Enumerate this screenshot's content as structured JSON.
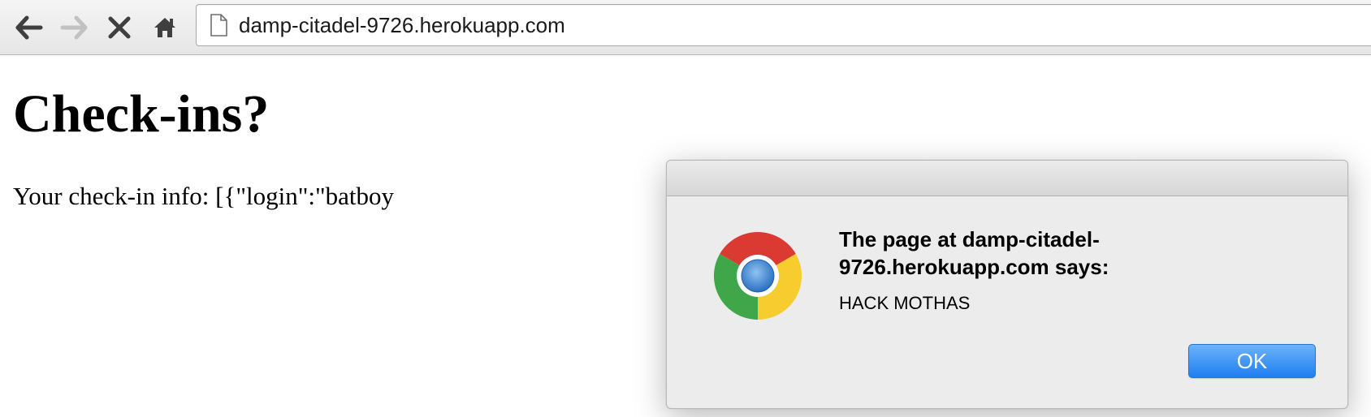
{
  "browser": {
    "url": "damp-citadel-9726.herokuapp.com",
    "icons": {
      "back": "arrow-left-icon",
      "forward": "arrow-right-icon",
      "stop": "close-icon",
      "home": "home-icon",
      "page": "page-icon"
    }
  },
  "page": {
    "title": "Check-ins?",
    "checkin_text": "Your check-in info: [{\"login\":\"batboy"
  },
  "dialog": {
    "heading": "The page at damp-citadel-9726.herokuapp.com says:",
    "message": "HACK MOTHAS",
    "ok_label": "OK",
    "icon": "chrome-logo-icon"
  },
  "colors": {
    "ok_button": "#1e7ff0",
    "dialog_background": "#ececec"
  }
}
